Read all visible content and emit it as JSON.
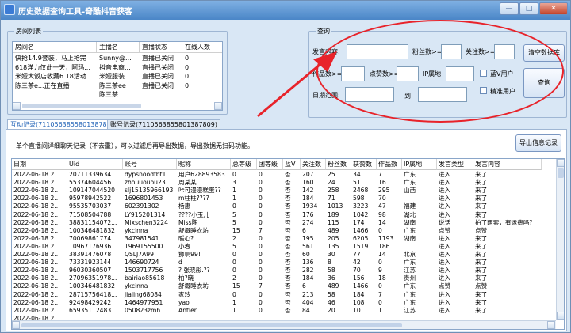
{
  "window": {
    "title": "历史数据查询工具-奇酷抖音获客",
    "buttons": [
      "—",
      "□",
      "✕"
    ]
  },
  "room_list": {
    "label": "房间列表",
    "columns": [
      "房间名",
      "主播名",
      "直播状态",
      "在线人数"
    ],
    "rows": [
      [
        "快抢14.9套装，马上抢完",
        "Sunny@...",
        "直播已关闭",
        "0"
      ],
      [
        "618洋力仅此一天，阿玛...",
        "抖音电商...",
        "直播已关闭",
        "0"
      ],
      [
        "米娅大饭店收藏6.18活动",
        "米娅服装...",
        "直播已关闭",
        "0"
      ],
      [
        "陈三茶e...正在直播",
        "陈三茶ee",
        "直播已关闭",
        "0"
      ],
      [
        "...",
        "陈三茶...",
        "...",
        "..."
      ]
    ]
  },
  "query": {
    "label": "查询",
    "fields": {
      "content": "发言内容:",
      "fans": "粉丝数>=",
      "follow": "关注数>=",
      "works": "作品数>=",
      "likes": "点赞数>=",
      "ip": "IP属地",
      "date_range": "日期范围:",
      "to": "到"
    },
    "checkboxes": [
      "蓝V用户",
      "精准用户"
    ],
    "buttons": {
      "clear": "清空数据库",
      "search": "查询"
    }
  },
  "tabs": [
    "互动记录(7110563855801387809)",
    "账号记录(7110563855801387809)"
  ],
  "interaction": {
    "info": "单个直播间详细聊天记录（不去重），可以过滤后再导出数据，导出数据无扫码功能。",
    "export_label": "导出信息记录",
    "columns": [
      "日期",
      "Uid",
      "账号",
      "昵称",
      "总等级",
      "团等级",
      "蓝V",
      "关注数",
      "粉丝数",
      "获赞数",
      "作品数",
      "IP属地",
      "发言类型",
      "发言内容"
    ],
    "rows": [
      [
        "2022-06-18 2...",
        "20711339634...",
        "dypsnoodfbt1",
        "用户628893583",
        "0",
        "0",
        "否",
        "207",
        "25",
        "34",
        "7",
        "广东",
        "进入",
        "来了"
      ],
      [
        "2022-06-18 2...",
        "55374604456...",
        "zhouuouou23",
        "周某某",
        "3",
        "0",
        "否",
        "160",
        "24",
        "51",
        "16",
        "广东",
        "进入",
        "来了"
      ],
      [
        "2022-06-18 2...",
        "109147044520",
        "slj15135966193",
        "咔可漫漫糕蛋??",
        "1",
        "0",
        "否",
        "142",
        "258",
        "2468",
        "295",
        "山西",
        "进入",
        "来了"
      ],
      [
        "2022-06-18 2...",
        "95978942522",
        "1696801453",
        "m柱柱????",
        "1",
        "0",
        "否",
        "184",
        "71",
        "598",
        "70",
        "",
        "进入",
        "来了"
      ],
      [
        "2022-06-18 2...",
        "95535703037",
        "602391302",
        "杨惠",
        "0",
        "0",
        "否",
        "1934",
        "1013",
        "3223",
        "47",
        "福建",
        "进入",
        "来了"
      ],
      [
        "2022-06-18 2...",
        "71508504788",
        "LY915201314",
        "????小玉儿",
        "5",
        "0",
        "否",
        "176",
        "189",
        "1042",
        "98",
        "湖北",
        "进入",
        "来了"
      ],
      [
        "2022-06-18 2...",
        "38831154072...",
        "Mixschen3224",
        "Miss陈",
        "5",
        "0",
        "否",
        "274",
        "115",
        "174",
        "14",
        "湖南",
        "说话",
        "拍了两套，有运费吗?"
      ],
      [
        "2022-06-18 2...",
        "100346481832",
        "ykcinna",
        "舒概睡衣坊",
        "15",
        "7",
        "否",
        "6",
        "489",
        "1466",
        "0",
        "广东",
        "点赞",
        "点赞"
      ],
      [
        "2022-06-18 2...",
        "70069861774",
        "347981541",
        "暖心?",
        "2",
        "0",
        "否",
        "195",
        "205",
        "6205",
        "1193",
        "湖南",
        "进入",
        "来了"
      ],
      [
        "2022-06-18 2...",
        "10967176936",
        "1969155500",
        "小春",
        "5",
        "0",
        "否",
        "561",
        "135",
        "1519",
        "186",
        "",
        "进入",
        "来了"
      ],
      [
        "2022-06-18 2...",
        "38391476078",
        "QSLJ7A99",
        "狮啊99!",
        "0",
        "0",
        "否",
        "60",
        "30",
        "77",
        "14",
        "北京",
        "进入",
        "来了"
      ],
      [
        "2022-06-18 2...",
        "73331923144",
        "146690724",
        "d",
        "0",
        "0",
        "否",
        "136",
        "8",
        "42",
        "0",
        "广东",
        "进入",
        "来了"
      ],
      [
        "2022-06-18 2...",
        "96030360507",
        "1503717756",
        "? 张晓彤.??",
        "0",
        "0",
        "否",
        "282",
        "58",
        "70",
        "9",
        "江苏",
        "进入",
        "来了"
      ],
      [
        "2022-06-18 2...",
        "27096351978...",
        "bairiao85618",
        "柏?晓",
        "2",
        "0",
        "否",
        "184",
        "36",
        "156",
        "18",
        "贵州",
        "进入",
        "来了"
      ],
      [
        "2022-06-18 2...",
        "100346481832",
        "ykcinna",
        "舒概睡衣坊",
        "15",
        "7",
        "否",
        "6",
        "489",
        "1466",
        "0",
        "广东",
        "点赞",
        "点赞"
      ],
      [
        "2022-06-18 2...",
        "28715756418...",
        "jialing68084",
        "家玲",
        "0",
        "0",
        "否",
        "213",
        "58",
        "184",
        "7",
        "广东",
        "进入",
        "来了"
      ],
      [
        "2022-06-18 2...",
        "92498429242",
        "1464977951",
        "yao",
        "1",
        "0",
        "否",
        "404",
        "46",
        "108",
        "0",
        "广东",
        "进入",
        "来了"
      ],
      [
        "2022-06-18 2...",
        "65935112483...",
        "050823zmh",
        "Antler",
        "1",
        "0",
        "否",
        "84",
        "20",
        "10",
        "1",
        "江苏",
        "进入",
        "来了"
      ],
      [
        "2022-06-18 2...",
        "",
        "",
        "",
        "",
        "",
        "",
        "",
        "",
        "",
        "",
        "",
        "",
        ""
      ]
    ]
  }
}
